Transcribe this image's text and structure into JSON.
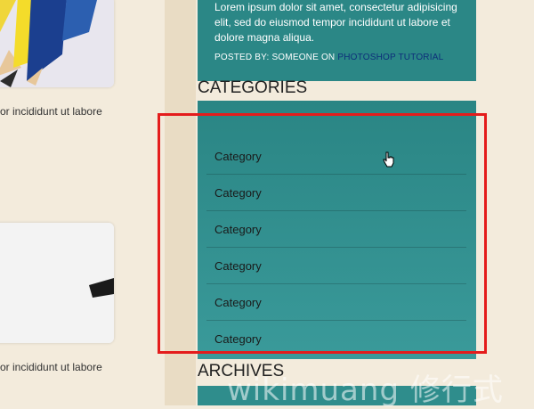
{
  "left": {
    "excerpt_1": "or incididunt ut labore",
    "excerpt_2": "or incididunt ut labore"
  },
  "post": {
    "text": "Lorem ipsum dolor sit amet, consectetur adipisicing elit, sed do eiusmod tempor incididunt ut labore et dolore magna aliqua.",
    "meta_prefix": "POSTED BY: SOMEONE ON ",
    "meta_link": "PHOTOSHOP TUTORIAL"
  },
  "categories": {
    "heading": "CATEGORIES",
    "items": [
      "Category",
      "Category",
      "Category",
      "Category",
      "Category",
      "Category"
    ]
  },
  "archives": {
    "heading": "ARCHIVES"
  },
  "watermark": "wikimuang 修行式",
  "colors": {
    "teal": "#2b8786",
    "highlight": "#e41c1c",
    "page_bg": "#f3ebdc"
  }
}
